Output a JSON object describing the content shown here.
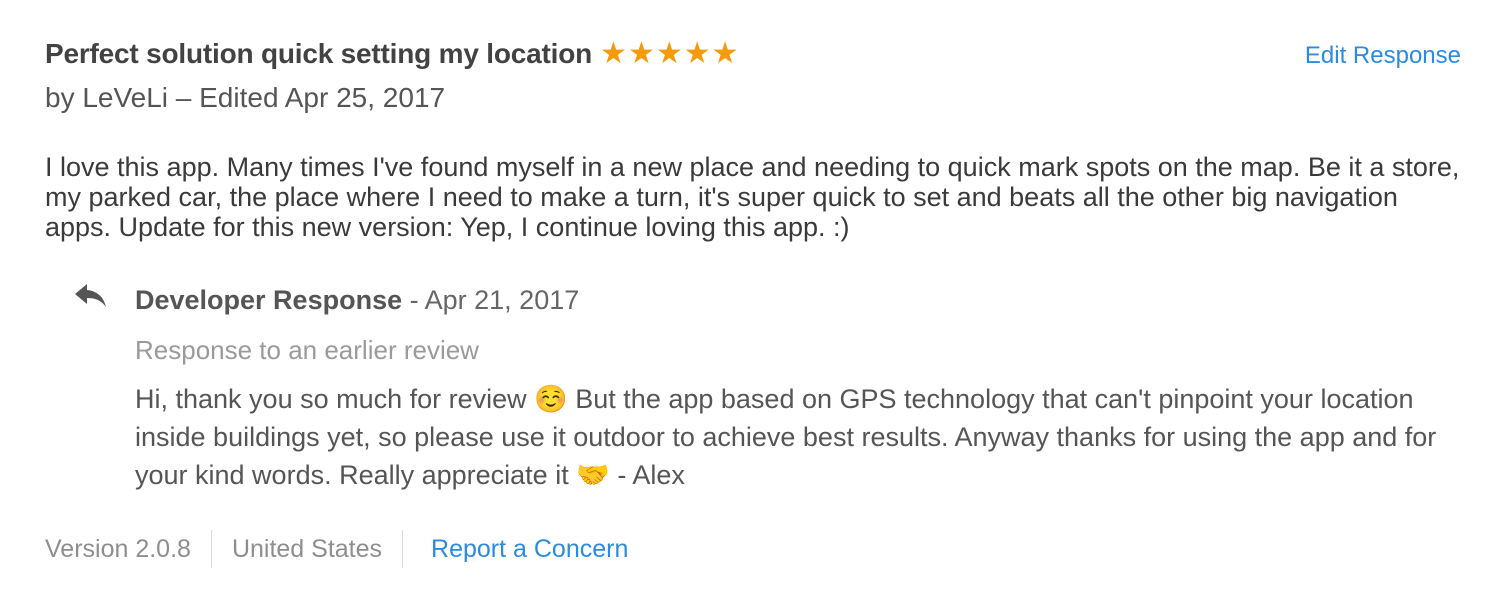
{
  "review": {
    "title": "Perfect solution quick setting my location",
    "rating": 5,
    "stars": [
      "★",
      "★",
      "★",
      "★",
      "★"
    ],
    "meta": "by LeVeLi – Edited Apr 25, 2017",
    "body": "I love this app. Many times I've found myself in a new place and needing to quick mark spots on the map. Be it a store, my parked car, the place where I need to make a turn, it's super quick to set and beats all the other big navigation apps. Update for this new version: Yep, I continue loving this app. :)",
    "edit_response_label": "Edit Response"
  },
  "developer_response": {
    "icon": "reply-icon",
    "title": "Developer Response",
    "separator": " - ",
    "date": "Apr 21, 2017",
    "subtitle": "Response to an earlier review",
    "body": "Hi, thank you so much for review ☺️ But the app based on GPS technology that can't pinpoint your location inside buildings yet, so please use it outdoor to achieve best results. Anyway thanks for using the app and for your kind words. Really appreciate it 🤝 - Alex"
  },
  "footer": {
    "version": "Version 2.0.8",
    "country": "United States",
    "report_label": "Report a Concern"
  },
  "colors": {
    "link": "#2a8be0",
    "star": "#f39b0c",
    "muted": "#8e8e8e"
  }
}
